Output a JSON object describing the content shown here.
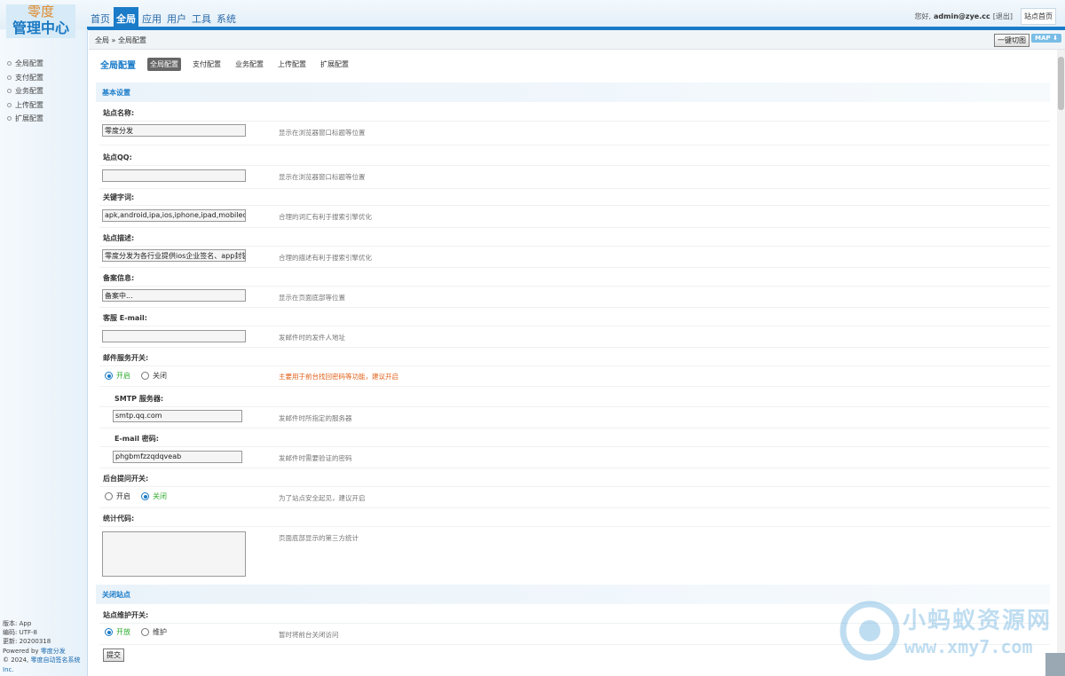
{
  "logo": {
    "line1": "零度",
    "line2": "管理中心"
  },
  "topnav": [
    "首页",
    "全局",
    "应用",
    "用户",
    "工具",
    "系统"
  ],
  "user": {
    "greeting": "您好,",
    "name": "admin@zye.cc",
    "logout": "[退出]",
    "site_home": "站点首页"
  },
  "sidebar": {
    "items": [
      "全局配置",
      "支付配置",
      "业务配置",
      "上传配置",
      "扩展配置"
    ],
    "footer": {
      "version": "版本: App",
      "encoding": "编码: UTF-8",
      "updated": "更新: 20200318",
      "powered_prefix": "Powered by ",
      "powered_link": "零度分发",
      "copyright_prefix": "© 2024, ",
      "copyright_link": "零度自动签名系统 Inc."
    }
  },
  "breadcrumb": "全局 » 全局配置",
  "toolbar": {
    "one_key": "一键切图",
    "map": "MAP ⬇"
  },
  "page_title": "全局配置",
  "tabs": [
    "全局配置",
    "支付配置",
    "业务配置",
    "上传配置",
    "扩展配置"
  ],
  "sections": {
    "basic": "基本设置",
    "close": "关闭站点"
  },
  "fields": {
    "site_name": {
      "label": "站点名称:",
      "value": "零度分发",
      "hint": "显示在浏览器窗口标题等位置"
    },
    "site_qq": {
      "label": "站点QQ:",
      "value": "",
      "hint": "显示在浏览器窗口标题等位置"
    },
    "keywords": {
      "label": "关键字词:",
      "value": "apk,android,ipa,ios,iphone,ipad,mobilec",
      "hint": "合理的词汇有利于搜索引擎优化"
    },
    "description": {
      "label": "站点描述:",
      "value": "零度分发为各行业提供ios企业签名、app封装",
      "hint": "合理的描述有利于搜索引擎优化"
    },
    "icp": {
      "label": "备案信息:",
      "value": "备案中...",
      "hint": "显示在页面底部等位置"
    },
    "service_email": {
      "label": "客服 E-mail:",
      "value": "",
      "hint": "发邮件时的发件人地址"
    },
    "mail_switch": {
      "label": "邮件服务开关:",
      "on": "开启",
      "off": "关闭",
      "hint": "主要用于前台找回密码等功能，建议开启"
    },
    "smtp": {
      "label": "SMTP 服务器:",
      "value": "smtp.qq.com",
      "hint": "发邮件时所指定的服务器"
    },
    "email_pwd": {
      "label": "E-mail 密码:",
      "value": "phgbmfzzqdqveab",
      "hint": "发邮件时需要验证的密码"
    },
    "admin_question": {
      "label": "后台提问开关:",
      "on": "开启",
      "off": "关闭",
      "hint": "为了站点安全起见，建议开启"
    },
    "stats_code": {
      "label": "统计代码:",
      "hint": "页面底部显示的第三方统计"
    },
    "maintenance": {
      "label": "站点维护开关:",
      "on": "开放",
      "off": "维护",
      "hint": "暂时将前台关闭访问"
    }
  },
  "submit_label": "提交",
  "watermark": {
    "text1": "小蚂蚁资源网",
    "text2": "www.xmy7.com"
  },
  "colors": {
    "accent": "#1a7bc8",
    "warn": "#e0601a",
    "on": "#2eab2e"
  }
}
